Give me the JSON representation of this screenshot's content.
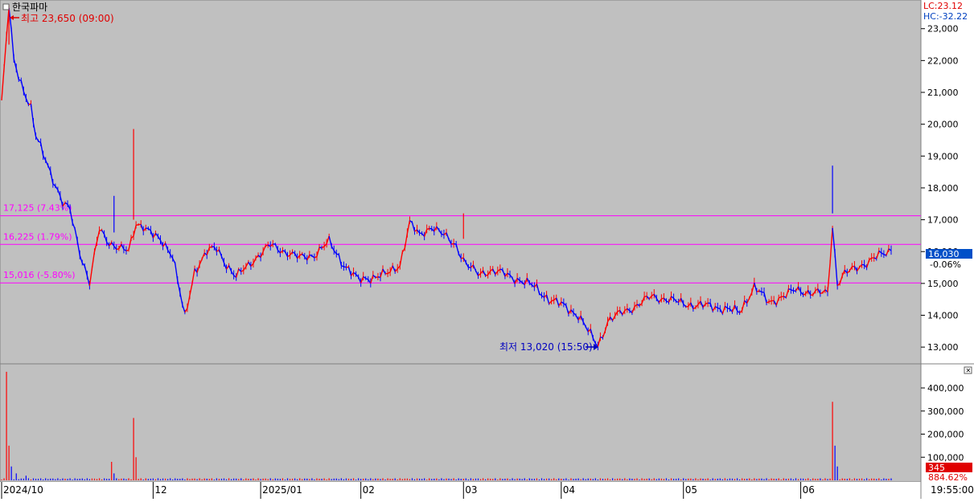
{
  "title": "한국파마",
  "indicators": {
    "lc": "LC:23.12",
    "hc": "HC:-32.22"
  },
  "colors": {
    "background": "#c0c0c0",
    "up": "#ff0000",
    "down": "#0000ff",
    "guide": "#ff00ff",
    "current_box": "#0050c8",
    "volume_box": "#e00000"
  },
  "annotations": {
    "high": "최고 23,650 (09:00)",
    "low": "최저 13,020 (15:50)"
  },
  "current": {
    "price": "16,030",
    "change": "-0.06%"
  },
  "volume_current": {
    "value": "345",
    "ratio": "884.62%"
  },
  "time_label": "19:55:00",
  "close_icon": "close-icon",
  "chart_data": [
    {
      "type": "line",
      "name": "price",
      "ylim": [
        12600,
        23800
      ],
      "y_ticks": [
        13000,
        14000,
        15000,
        16000,
        17000,
        18000,
        19000,
        20000,
        21000,
        22000,
        23000
      ],
      "y_tick_labels": [
        "13,000",
        "14,000",
        "15,000",
        "16,000",
        "17,000",
        "18,000",
        "19,000",
        "20,000",
        "21,000",
        "22,000",
        "23,000"
      ],
      "x_labels": [
        "2024/10",
        "12",
        "2025/01",
        "02",
        "03",
        "04",
        "05",
        "06"
      ],
      "x_label_index": [
        0,
        62,
        106,
        147,
        189,
        229,
        279,
        327
      ],
      "x_count": 365,
      "guide_lines": [
        {
          "value": 17125,
          "label": "17,125 (7.43%)"
        },
        {
          "value": 16225,
          "label": "16,225 (1.79%)"
        },
        {
          "value": 15016,
          "label": "15,016 (-5.80%)"
        }
      ],
      "high": {
        "index": 3,
        "value": 23650
      },
      "low": {
        "index": 244,
        "value": 13020
      },
      "current": {
        "value": 16030
      },
      "keypoints": [
        [
          0,
          20700
        ],
        [
          3,
          23650
        ],
        [
          5,
          22000
        ],
        [
          8,
          21300
        ],
        [
          12,
          20500
        ],
        [
          14,
          19600
        ],
        [
          18,
          18900
        ],
        [
          21,
          18300
        ],
        [
          25,
          17500
        ],
        [
          28,
          17300
        ],
        [
          32,
          16000
        ],
        [
          36,
          15000
        ],
        [
          40,
          16700
        ],
        [
          44,
          16300
        ],
        [
          48,
          16100
        ],
        [
          52,
          16000
        ],
        [
          55,
          16900
        ],
        [
          58,
          16800
        ],
        [
          62,
          16500
        ],
        [
          66,
          16300
        ],
        [
          70,
          15900
        ],
        [
          75,
          13900
        ],
        [
          79,
          15400
        ],
        [
          84,
          16000
        ],
        [
          88,
          16100
        ],
        [
          92,
          15600
        ],
        [
          96,
          15200
        ],
        [
          100,
          15500
        ],
        [
          104,
          15800
        ],
        [
          110,
          16200
        ],
        [
          116,
          16000
        ],
        [
          122,
          15800
        ],
        [
          128,
          15900
        ],
        [
          134,
          16300
        ],
        [
          140,
          15600
        ],
        [
          146,
          15100
        ],
        [
          152,
          15200
        ],
        [
          158,
          15300
        ],
        [
          163,
          15600
        ],
        [
          167,
          16900
        ],
        [
          171,
          16500
        ],
        [
          176,
          16800
        ],
        [
          181,
          16500
        ],
        [
          186,
          16200
        ],
        [
          190,
          15600
        ],
        [
          195,
          15300
        ],
        [
          200,
          15400
        ],
        [
          206,
          15300
        ],
        [
          212,
          15100
        ],
        [
          218,
          14900
        ],
        [
          224,
          14500
        ],
        [
          230,
          14300
        ],
        [
          236,
          14000
        ],
        [
          240,
          13500
        ],
        [
          244,
          13050
        ],
        [
          248,
          13800
        ],
        [
          254,
          14100
        ],
        [
          260,
          14300
        ],
        [
          266,
          14600
        ],
        [
          272,
          14500
        ],
        [
          278,
          14400
        ],
        [
          284,
          14300
        ],
        [
          290,
          14300
        ],
        [
          296,
          14200
        ],
        [
          302,
          14100
        ],
        [
          308,
          14900
        ],
        [
          314,
          14400
        ],
        [
          320,
          14600
        ],
        [
          325,
          14800
        ],
        [
          332,
          14700
        ],
        [
          338,
          14700
        ],
        [
          340,
          16800
        ],
        [
          342,
          15000
        ],
        [
          345,
          15300
        ],
        [
          350,
          15500
        ],
        [
          355,
          15700
        ],
        [
          360,
          15900
        ],
        [
          364,
          16030
        ]
      ]
    },
    {
      "type": "bar",
      "name": "volume",
      "ylim": [
        0,
        480000
      ],
      "y_ticks": [
        100000,
        200000,
        300000,
        400000
      ],
      "y_tick_labels": [
        "100,000",
        "200,000",
        "300,000",
        "400,000"
      ],
      "spikes": [
        [
          2,
          470000
        ],
        [
          3,
          150000
        ],
        [
          4,
          60000
        ],
        [
          6,
          30000
        ],
        [
          10,
          20000
        ],
        [
          45,
          80000
        ],
        [
          46,
          30000
        ],
        [
          54,
          270000
        ],
        [
          55,
          100000
        ],
        [
          340,
          340000
        ],
        [
          341,
          150000
        ],
        [
          342,
          60000
        ]
      ],
      "baseline": 6000
    }
  ]
}
